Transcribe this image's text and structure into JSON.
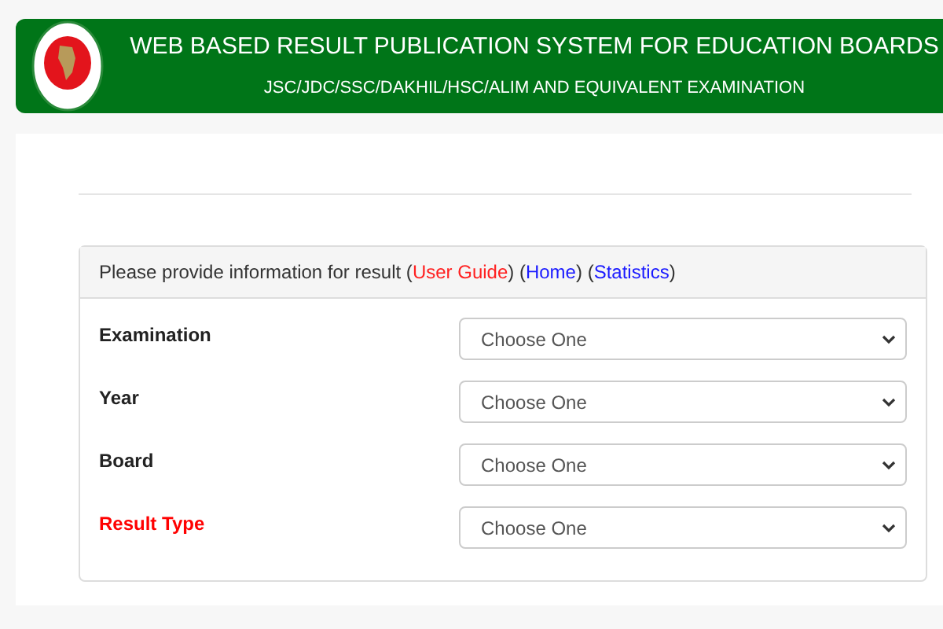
{
  "header": {
    "title": "WEB BASED RESULT PUBLICATION SYSTEM FOR EDUCATION BOARDS",
    "subtitle": "JSC/JDC/SSC/DAKHIL/HSC/ALIM AND EQUIVALENT EXAMINATION"
  },
  "form": {
    "intro": [
      {
        "kind": "text",
        "text": "Please provide information for result ("
      },
      {
        "kind": "link",
        "text": "User Guide",
        "color": "#ff2020"
      },
      {
        "kind": "text",
        "text": ") ("
      },
      {
        "kind": "link",
        "text": "Home",
        "color": "#1a1aff"
      },
      {
        "kind": "text",
        "text": ") ("
      },
      {
        "kind": "link",
        "text": "Statistics",
        "color": "#1a1aff"
      },
      {
        "kind": "text",
        "text": ")"
      }
    ],
    "fields": [
      {
        "label": "Examination",
        "value": "Choose One",
        "color": "#222222"
      },
      {
        "label": "Year",
        "value": "Choose One",
        "color": "#222222"
      },
      {
        "label": "Board",
        "value": "Choose One",
        "color": "#222222"
      },
      {
        "label": "Result Type",
        "value": "Choose One",
        "color": "#ff0000"
      }
    ]
  }
}
